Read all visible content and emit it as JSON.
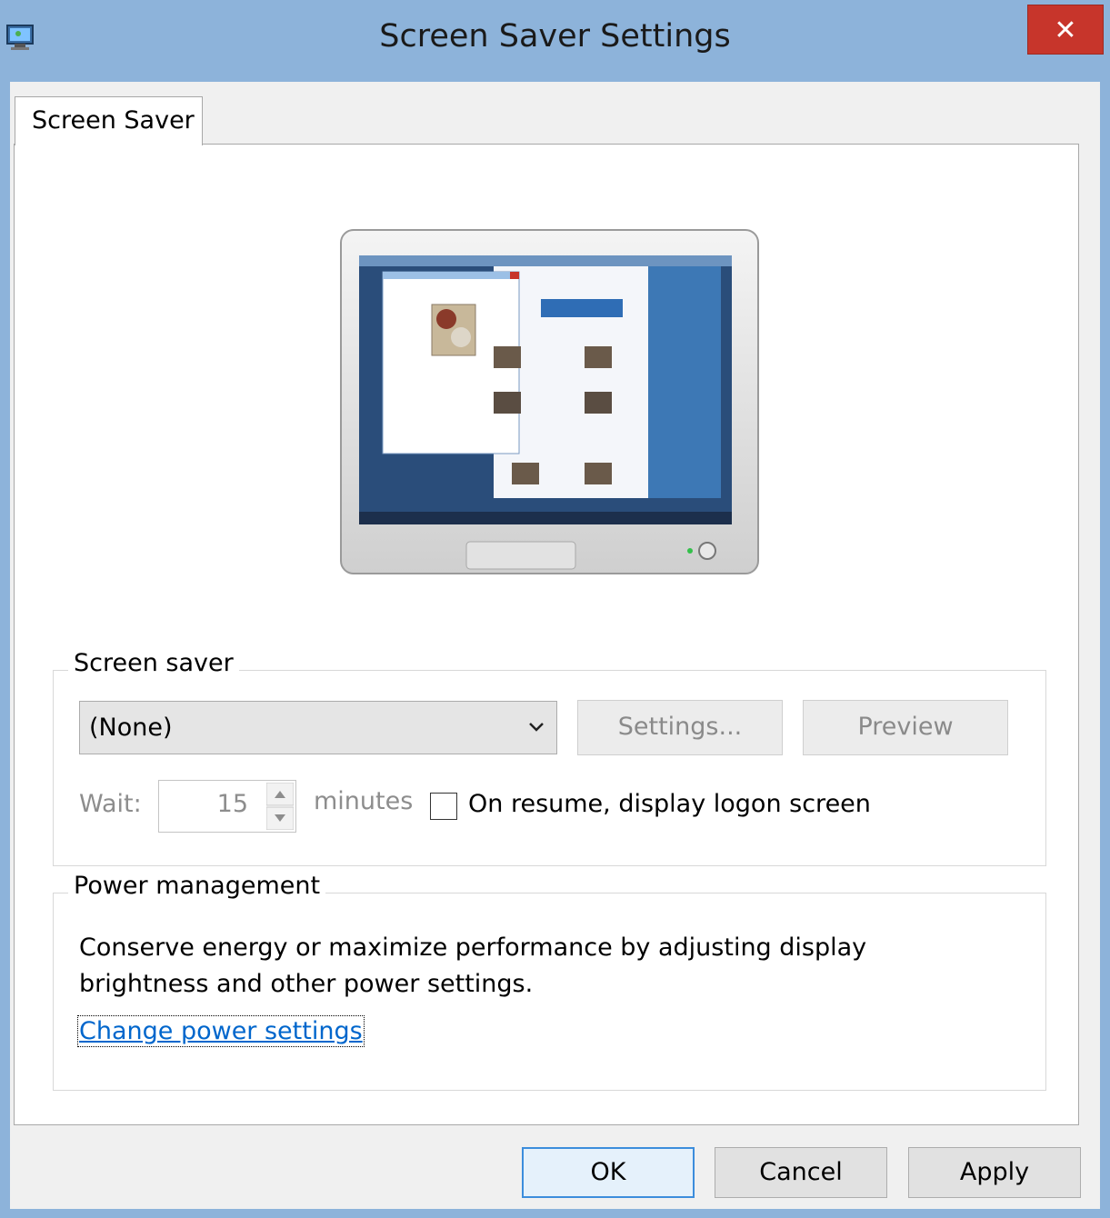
{
  "window": {
    "title": "Screen Saver Settings",
    "close_glyph": "✕",
    "icon": "display-settings-icon"
  },
  "tabs": [
    {
      "label": "Screen Saver",
      "selected": true
    }
  ],
  "screen_saver": {
    "group_label": "Screen saver",
    "selected": "(None)",
    "settings_label": "Settings...",
    "preview_label": "Preview",
    "wait_label": "Wait:",
    "wait_value": "15",
    "minutes_label": "minutes",
    "logon_label": "On resume, display logon screen",
    "logon_checked": false
  },
  "power": {
    "group_label": "Power management",
    "description_line1": "Conserve energy or maximize performance by adjusting display",
    "description_line2": "brightness and other power settings.",
    "link_label": "Change power settings"
  },
  "footer": {
    "ok_label": "OK",
    "cancel_label": "Cancel",
    "apply_label": "Apply"
  },
  "colors": {
    "titlebar": "#8db3da",
    "close": "#c7352b",
    "link": "#0066cc",
    "default_button_border": "#3c8ddc"
  }
}
